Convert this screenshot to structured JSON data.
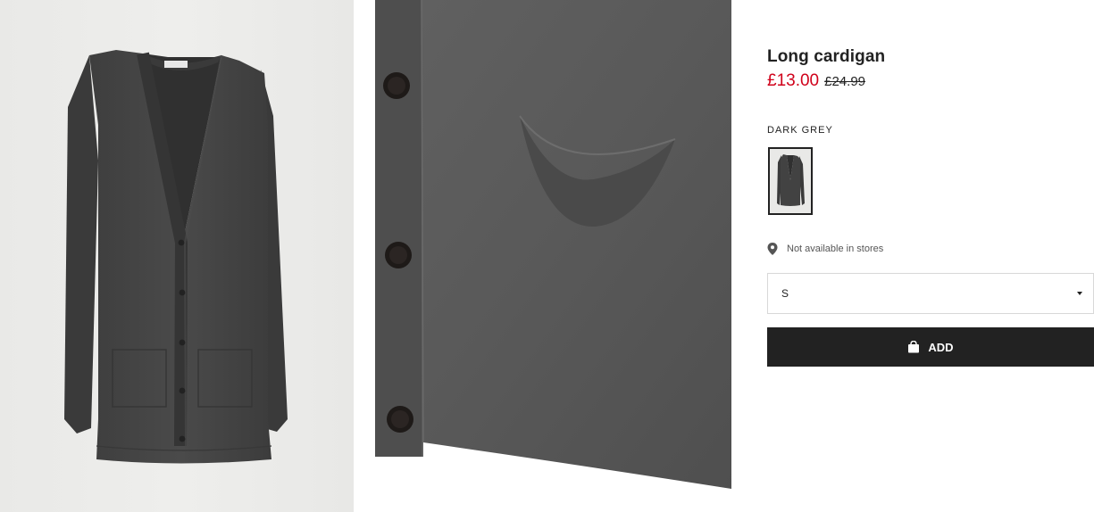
{
  "product": {
    "name": "Long cardigan",
    "sale_price": "£13.00",
    "original_price": "£24.99",
    "sale_color": "#d0021b"
  },
  "images": {
    "main_alt": "Long cardigan product image",
    "detail_alt": "Long cardigan detail image"
  },
  "color": {
    "label": "DARK GREY",
    "swatch_alt": "Dark grey swatch"
  },
  "availability": {
    "icon": "location-pin-icon",
    "text": "Not available in stores"
  },
  "size_select": {
    "value": "S",
    "icon": "caret-down-icon"
  },
  "add_button": {
    "label": "ADD",
    "icon": "shopping-bag-icon",
    "background": "#222222"
  }
}
